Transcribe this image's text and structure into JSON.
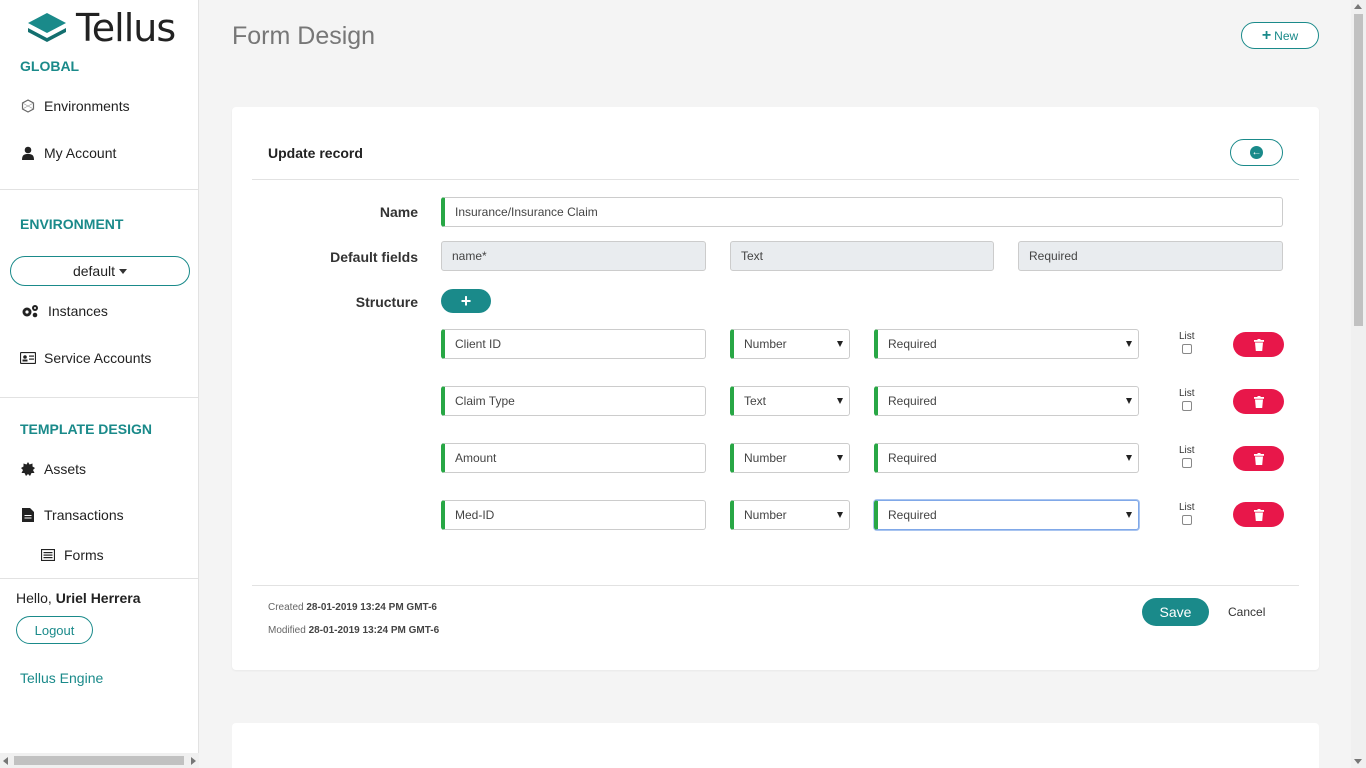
{
  "brand": {
    "name": "Tellus"
  },
  "sidebar": {
    "global_title": "GLOBAL",
    "global_items": [
      {
        "label": "Environments",
        "icon": "hexagon-icon"
      },
      {
        "label": "My Account",
        "icon": "user-icon"
      }
    ],
    "environment_title": "ENVIRONMENT",
    "environment_selected": "default",
    "environment_items": [
      {
        "label": "Instances",
        "icon": "gears-icon"
      },
      {
        "label": "Service Accounts",
        "icon": "id-card-icon"
      }
    ],
    "template_title": "TEMPLATE DESIGN",
    "template_items": [
      {
        "label": "Assets",
        "icon": "gear-icon"
      },
      {
        "label": "Transactions",
        "icon": "document-icon"
      },
      {
        "label": "Forms",
        "icon": "list-icon"
      }
    ],
    "hello_prefix": "Hello, ",
    "user_name": "Uriel Herrera",
    "logout_label": "Logout",
    "engine_link": "Tellus Engine"
  },
  "header": {
    "title": "Form Design",
    "new_label": "New"
  },
  "form": {
    "card_title": "Update record",
    "name_label": "Name",
    "name_value": "Insurance/Insurance Claim",
    "default_fields_label": "Default fields",
    "default_fields": [
      "name*",
      "Text",
      "Required"
    ],
    "structure_label": "Structure",
    "list_label": "List",
    "rows": [
      {
        "name": "Client ID",
        "type": "Number",
        "requirement": "Required"
      },
      {
        "name": "Claim Type",
        "type": "Text",
        "requirement": "Required"
      },
      {
        "name": "Amount",
        "type": "Number",
        "requirement": "Required"
      },
      {
        "name": "Med-ID",
        "type": "Number",
        "requirement": "Required"
      }
    ],
    "created_label": "Created ",
    "created_value": "28-01-2019 13:24 PM GMT-6",
    "modified_label": "Modified ",
    "modified_value": "28-01-2019 13:24 PM GMT-6",
    "save_label": "Save",
    "cancel_label": "Cancel"
  },
  "colors": {
    "accent": "#1a8a8a",
    "danger": "#e8174a",
    "success": "#28a745"
  }
}
